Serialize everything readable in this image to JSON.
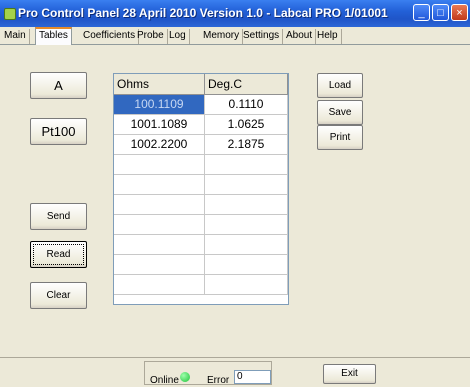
{
  "window": {
    "title": "Pro Control Panel 28 April 2010 Version 1.0 - Labcal PRO 1/01001",
    "minimize": "_",
    "maximize": "□",
    "close": "×"
  },
  "tabs": [
    {
      "label": "Main",
      "active": false
    },
    {
      "label": "Tables",
      "active": true
    },
    {
      "label": "Coefficients",
      "active": false
    },
    {
      "label": "Probe",
      "active": false
    },
    {
      "label": "Log",
      "active": false
    },
    {
      "label": "Memory",
      "active": false
    },
    {
      "label": "Settings",
      "active": false
    },
    {
      "label": "About",
      "active": false
    },
    {
      "label": "Help",
      "active": false
    }
  ],
  "left_panel": {
    "unit_button": "A",
    "sensor_button": "Pt100",
    "send_button": "Send",
    "read_button": "Read",
    "clear_button": "Clear"
  },
  "table": {
    "headers": [
      "Ohms",
      "Deg.C"
    ],
    "rows": [
      [
        "100.1109",
        "0.1110"
      ],
      [
        "1001.1089",
        "1.0625"
      ],
      [
        "1002.2200",
        "2.1875"
      ],
      [
        "",
        ""
      ],
      [
        "",
        ""
      ],
      [
        "",
        ""
      ],
      [
        "",
        ""
      ],
      [
        "",
        ""
      ],
      [
        "",
        ""
      ],
      [
        "",
        ""
      ]
    ],
    "selected_cell": [
      0,
      0
    ]
  },
  "right_panel": {
    "load_button": "Load",
    "save_button": "Save",
    "print_button": "Print"
  },
  "status": {
    "online_label": "Online",
    "online_color": "#1fc23a",
    "error_label": "Error",
    "error_value": "0",
    "exit_button": "Exit"
  },
  "colors": {
    "titlebar": "#2361d8",
    "selection": "#3168c0",
    "tab_highlight": "#e68b2c"
  }
}
